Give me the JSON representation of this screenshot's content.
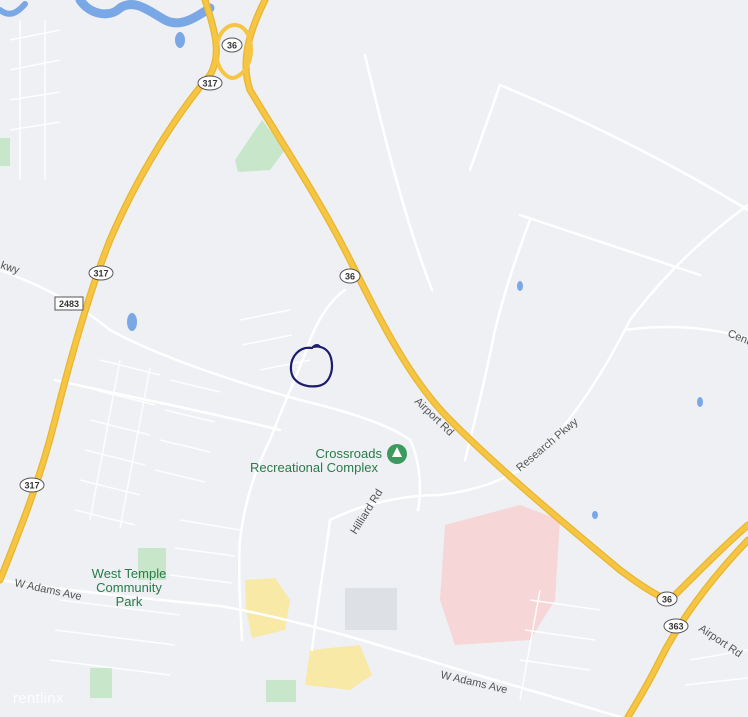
{
  "map": {
    "highway_shields": [
      "36",
      "317",
      "317",
      "36",
      "2483",
      "317",
      "36",
      "363"
    ],
    "road_labels": {
      "airport_rd_main": "Airport Rd",
      "airport_rd_se": "Airport Rd",
      "research_pkwy": "Research Pkwy",
      "hilliard_rd": "Hilliard Rd",
      "w_adams_ave_west": "W Adams Ave",
      "w_adams_ave_south": "W Adams Ave",
      "centr_partial": "Centr",
      "west_edge_partial": "kwy"
    },
    "pois": {
      "crossroads_line1": "Crossroads",
      "crossroads_line2": "Recreational Complex",
      "west_temple_line1": "West Temple",
      "west_temple_line2": "Community",
      "west_temple_line3": "Park"
    },
    "watermark": "rentlinx",
    "colors": {
      "background": "#eef0f3",
      "highway": "#f5c543",
      "minor_road": "#ffffff",
      "water": "#7aa7e6",
      "park": "#c8e6c9",
      "commercial": "#f8e9a7",
      "hospital": "#f6d6d6",
      "marker": "#1c1c6b"
    }
  }
}
